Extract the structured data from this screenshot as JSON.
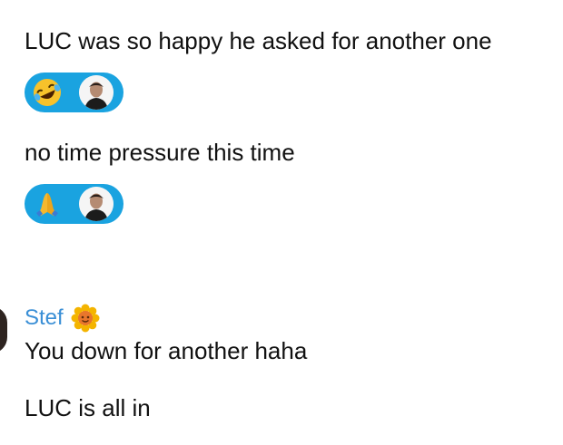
{
  "messages": [
    {
      "text": "LUC was so happy he asked for another one",
      "reaction_emoji": "rolling-on-floor-laughing-emoji"
    },
    {
      "text": "no time pressure this time",
      "reaction_emoji": "folded-hands-emoji"
    }
  ],
  "sender": {
    "name": "Stef",
    "badge_icon": "sun-flower-emoji"
  },
  "sender_messages": [
    "You down for another haha",
    "LUC is all in"
  ],
  "colors": {
    "reaction_bg": "#1aa3e0",
    "sender_name": "#3a8fd6",
    "text": "#111111"
  }
}
